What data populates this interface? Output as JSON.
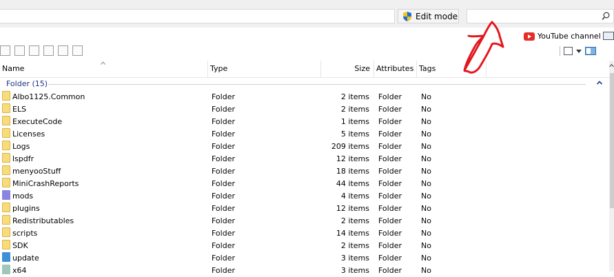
{
  "toolbar_top": {
    "edit_mode_label": "Edit mode"
  },
  "youtube": {
    "label": "YouTube channel"
  },
  "columns": {
    "name": "Name",
    "type": "Type",
    "size": "Size",
    "attributes": "Attributes",
    "tags": "Tags"
  },
  "group": {
    "label": "Folder (15)"
  },
  "rows": [
    {
      "name": "Albo1125.Common",
      "type": "Folder",
      "size": "2 items",
      "attributes": "Folder",
      "tags": "No",
      "icon": "folder-icon"
    },
    {
      "name": "ELS",
      "type": "Folder",
      "size": "2 items",
      "attributes": "Folder",
      "tags": "No",
      "icon": "folder-icon"
    },
    {
      "name": "ExecuteCode",
      "type": "Folder",
      "size": "1 items",
      "attributes": "Folder",
      "tags": "No",
      "icon": "folder-icon"
    },
    {
      "name": "Licenses",
      "type": "Folder",
      "size": "5 items",
      "attributes": "Folder",
      "tags": "No",
      "icon": "folder-icon"
    },
    {
      "name": "Logs",
      "type": "Folder",
      "size": "209 items",
      "attributes": "Folder",
      "tags": "No",
      "icon": "folder-icon"
    },
    {
      "name": "lspdfr",
      "type": "Folder",
      "size": "12 items",
      "attributes": "Folder",
      "tags": "No",
      "icon": "folder-icon"
    },
    {
      "name": "menyooStuff",
      "type": "Folder",
      "size": "18 items",
      "attributes": "Folder",
      "tags": "No",
      "icon": "folder-icon"
    },
    {
      "name": "MiniCrashReports",
      "type": "Folder",
      "size": "44 items",
      "attributes": "Folder",
      "tags": "No",
      "icon": "folder-icon"
    },
    {
      "name": "mods",
      "type": "Folder",
      "size": "4 items",
      "attributes": "Folder",
      "tags": "No",
      "icon": "mods-folder-icon"
    },
    {
      "name": "plugins",
      "type": "Folder",
      "size": "12 items",
      "attributes": "Folder",
      "tags": "No",
      "icon": "folder-icon"
    },
    {
      "name": "Redistributables",
      "type": "Folder",
      "size": "2 items",
      "attributes": "Folder",
      "tags": "No",
      "icon": "folder-icon"
    },
    {
      "name": "scripts",
      "type": "Folder",
      "size": "14 items",
      "attributes": "Folder",
      "tags": "No",
      "icon": "folder-icon"
    },
    {
      "name": "SDK",
      "type": "Folder",
      "size": "2 items",
      "attributes": "Folder",
      "tags": "No",
      "icon": "folder-icon"
    },
    {
      "name": "update",
      "type": "Folder",
      "size": "3 items",
      "attributes": "Folder",
      "tags": "No",
      "icon": "update-folder-icon"
    },
    {
      "name": "x64",
      "type": "Folder",
      "size": "3 items",
      "attributes": "Folder",
      "tags": "No",
      "icon": "x64-folder-icon"
    }
  ],
  "colors": {
    "folder": "#f8dc7c",
    "mods": "#8a84e0",
    "update": "#3c8fd8",
    "x64": "#9fc7b9",
    "group_text": "#1e3287",
    "annotation": "#e4161c"
  }
}
